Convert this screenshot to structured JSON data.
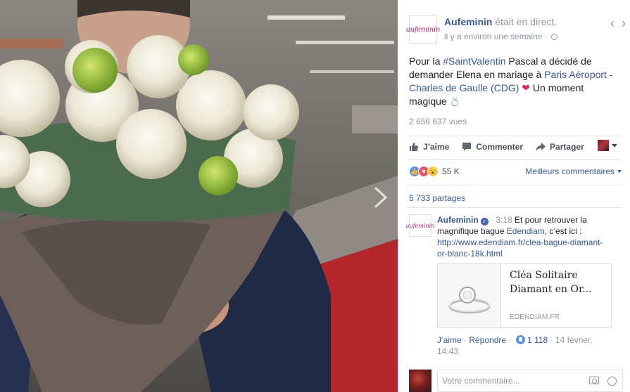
{
  "page": {
    "logo_text": "aufeminin",
    "name": "Aufeminin",
    "status": " était en direct.",
    "time": "il y a environ une semaine · "
  },
  "post": {
    "pre": "Pour la ",
    "hashtag": "#SaintValentin",
    "mid": " Pascal a décidé de demander Elena en mariage à ",
    "place": "Paris Aéroport - Charles de Gaulle (CDG)",
    "heart": " ❤",
    "end": " Un moment magique ",
    "ring": "💍"
  },
  "views": "2 656 637 vues",
  "actions": {
    "like": "J’aime",
    "comment": "Commenter",
    "share": "Partager"
  },
  "reactions": {
    "count": "55 K",
    "sort_label": "Meilleurs commentaires"
  },
  "shares": "5 733 partages",
  "comment": {
    "author": "Aufeminin",
    "time": " · 3:18",
    "text_pre": " Et pour retrouver la magnifique bague ",
    "mention": "Edendiam",
    "text_post": ", c’est ici : ",
    "url": "http://www.edendiam.fr/clea-bague-diamant-or-blanc-18k.html",
    "preview_title": "Cléa Solitaire Diamant en Or...",
    "preview_domain": "EDENDIAM.FR",
    "like": "J’aime",
    "reply": "Répondre",
    "like_count": " 1 118",
    "date": " · 14 février, 14:43"
  },
  "composer": {
    "placeholder": "Votre commentaire..."
  },
  "icons": [
    "chevron-left-icon",
    "chevron-right-icon",
    "globe-icon",
    "thumbs-up-icon",
    "comment-icon",
    "share-icon",
    "camera-icon",
    "smiley-icon",
    "verified-icon"
  ],
  "colors": {
    "link": "#365899",
    "muted": "#90949c",
    "brand": "#c4206b",
    "like_blue": "#5890ff",
    "love_red": "#f25268"
  }
}
